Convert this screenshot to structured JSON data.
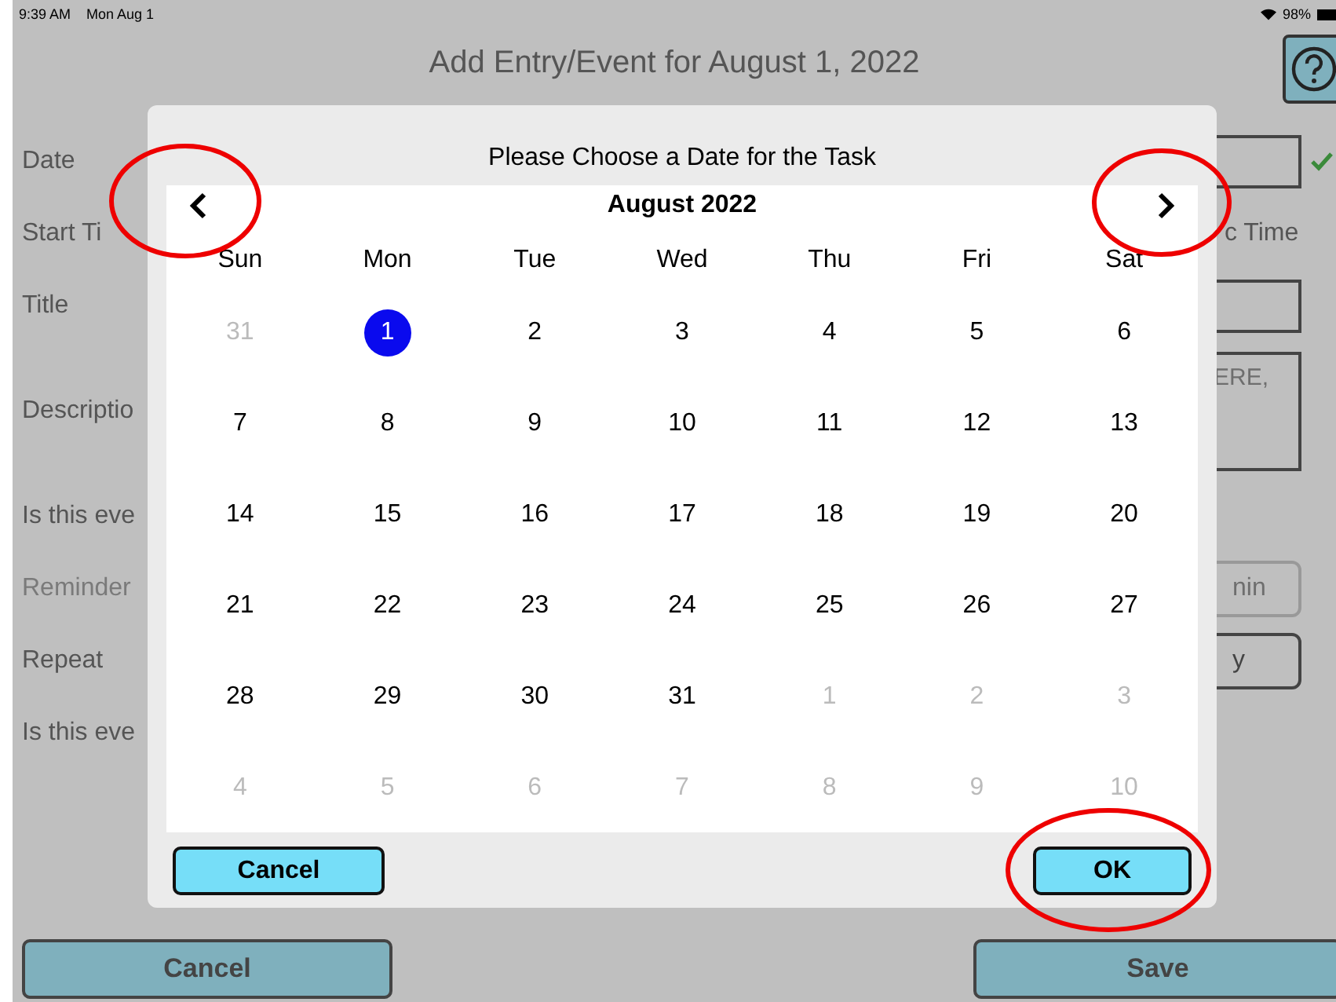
{
  "status_bar": {
    "time": "9:39 AM",
    "date": "Mon Aug 1",
    "battery": "98%"
  },
  "screen": {
    "title": "Add Entry/Event for August 1, 2022"
  },
  "form_rows": [
    {
      "label": "Date",
      "disabled": false,
      "kind": "field",
      "valid": true
    },
    {
      "label": "Start Ti",
      "disabled": false,
      "kind": "text",
      "text": "c Time"
    },
    {
      "label": "Title",
      "disabled": false,
      "kind": "field"
    },
    {
      "label": "Descriptio",
      "disabled": false,
      "kind": "area",
      "placeholder": "ERE,"
    },
    {
      "label": "Is this eve",
      "disabled": false,
      "kind": "none"
    },
    {
      "label": "Reminder",
      "disabled": true,
      "kind": "button",
      "text": "nin"
    },
    {
      "label": "Repeat",
      "disabled": false,
      "kind": "button",
      "text": "y"
    },
    {
      "label": "Is this eve",
      "disabled": false,
      "kind": "none"
    }
  ],
  "bottom_buttons": [
    "Cancel",
    "Save"
  ],
  "dialog": {
    "title": "Please Choose a Date for the Task",
    "month": "August 2022",
    "weekdays": [
      "Sun",
      "Mon",
      "Tue",
      "Wed",
      "Thu",
      "Fri",
      "Sat"
    ],
    "days": [
      {
        "day": "31",
        "in_month": false,
        "selected": false
      },
      {
        "day": "1",
        "in_month": true,
        "selected": true
      },
      {
        "day": "2",
        "in_month": true,
        "selected": false
      },
      {
        "day": "3",
        "in_month": true,
        "selected": false
      },
      {
        "day": "4",
        "in_month": true,
        "selected": false
      },
      {
        "day": "5",
        "in_month": true,
        "selected": false
      },
      {
        "day": "6",
        "in_month": true,
        "selected": false
      },
      {
        "day": "7",
        "in_month": true,
        "selected": false
      },
      {
        "day": "8",
        "in_month": true,
        "selected": false
      },
      {
        "day": "9",
        "in_month": true,
        "selected": false
      },
      {
        "day": "10",
        "in_month": true,
        "selected": false
      },
      {
        "day": "11",
        "in_month": true,
        "selected": false
      },
      {
        "day": "12",
        "in_month": true,
        "selected": false
      },
      {
        "day": "13",
        "in_month": true,
        "selected": false
      },
      {
        "day": "14",
        "in_month": true,
        "selected": false
      },
      {
        "day": "15",
        "in_month": true,
        "selected": false
      },
      {
        "day": "16",
        "in_month": true,
        "selected": false
      },
      {
        "day": "17",
        "in_month": true,
        "selected": false
      },
      {
        "day": "18",
        "in_month": true,
        "selected": false
      },
      {
        "day": "19",
        "in_month": true,
        "selected": false
      },
      {
        "day": "20",
        "in_month": true,
        "selected": false
      },
      {
        "day": "21",
        "in_month": true,
        "selected": false
      },
      {
        "day": "22",
        "in_month": true,
        "selected": false
      },
      {
        "day": "23",
        "in_month": true,
        "selected": false
      },
      {
        "day": "24",
        "in_month": true,
        "selected": false
      },
      {
        "day": "25",
        "in_month": true,
        "selected": false
      },
      {
        "day": "26",
        "in_month": true,
        "selected": false
      },
      {
        "day": "27",
        "in_month": true,
        "selected": false
      },
      {
        "day": "28",
        "in_month": true,
        "selected": false
      },
      {
        "day": "29",
        "in_month": true,
        "selected": false
      },
      {
        "day": "30",
        "in_month": true,
        "selected": false
      },
      {
        "day": "31",
        "in_month": true,
        "selected": false
      },
      {
        "day": "1",
        "in_month": false,
        "selected": false
      },
      {
        "day": "2",
        "in_month": false,
        "selected": false
      },
      {
        "day": "3",
        "in_month": false,
        "selected": false
      },
      {
        "day": "4",
        "in_month": false,
        "selected": false
      },
      {
        "day": "5",
        "in_month": false,
        "selected": false
      },
      {
        "day": "6",
        "in_month": false,
        "selected": false
      },
      {
        "day": "7",
        "in_month": false,
        "selected": false
      },
      {
        "day": "8",
        "in_month": false,
        "selected": false
      },
      {
        "day": "9",
        "in_month": false,
        "selected": false
      },
      {
        "day": "10",
        "in_month": false,
        "selected": false
      }
    ],
    "buttons": [
      "Cancel",
      "OK"
    ]
  }
}
